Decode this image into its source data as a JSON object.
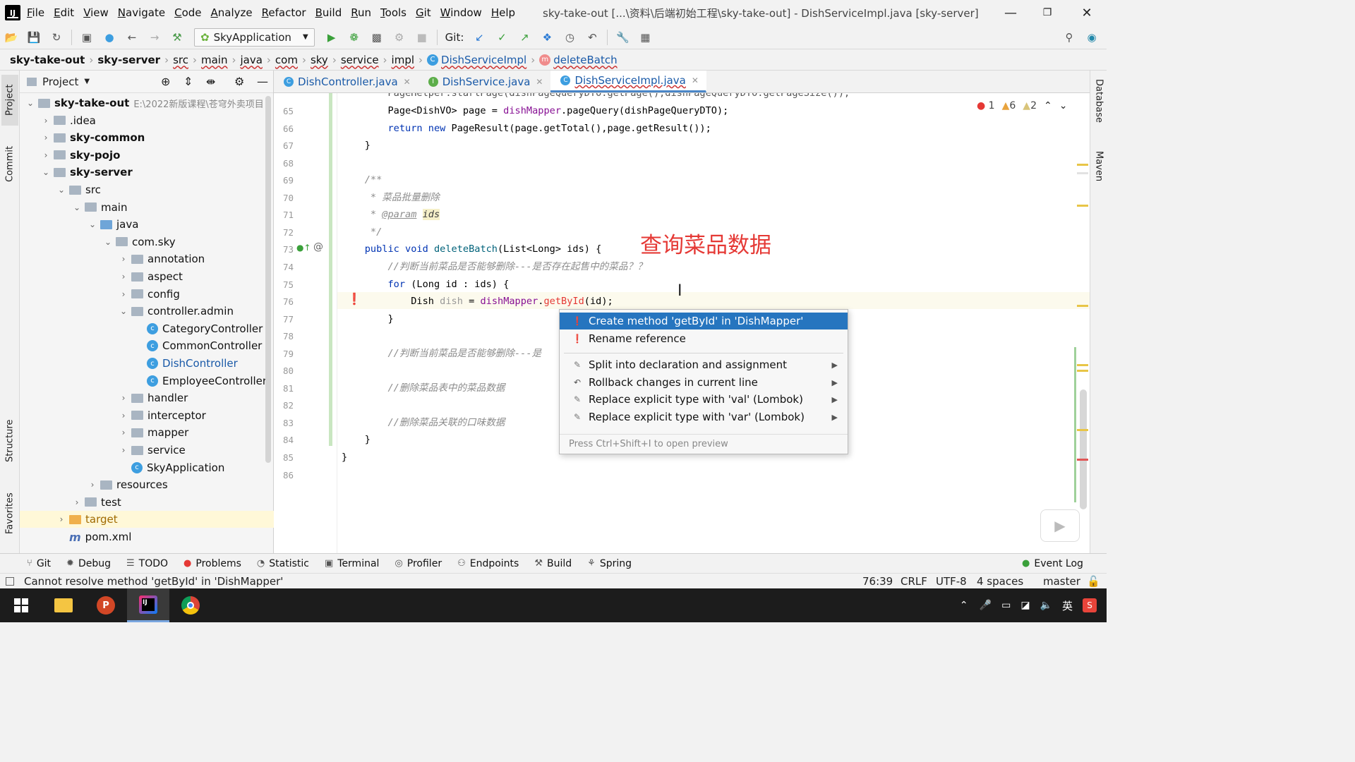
{
  "menu": [
    "File",
    "Edit",
    "View",
    "Navigate",
    "Code",
    "Analyze",
    "Refactor",
    "Build",
    "Run",
    "Tools",
    "Git",
    "Window",
    "Help"
  ],
  "window_title": "sky-take-out [...\\资料\\后端初始工程\\sky-take-out] - DishServiceImpl.java [sky-server]",
  "toolbar": {
    "run_config": "SkyApplication",
    "git_label": "Git:"
  },
  "breadcrumb": [
    "sky-take-out",
    "sky-server",
    "src",
    "main",
    "java",
    "com",
    "sky",
    "service",
    "impl",
    "DishServiceImpl",
    "deleteBatch"
  ],
  "project_panel": {
    "title": "Project",
    "tree": [
      {
        "label": "sky-take-out",
        "path": "E:\\2022新版课程\\苍穹外卖项目",
        "indent": 0,
        "arrow": "v",
        "icon": "module",
        "bold": true
      },
      {
        "label": ".idea",
        "indent": 1,
        "arrow": ">",
        "icon": "folder"
      },
      {
        "label": "sky-common",
        "indent": 1,
        "arrow": ">",
        "icon": "module",
        "bold": true
      },
      {
        "label": "sky-pojo",
        "indent": 1,
        "arrow": ">",
        "icon": "module",
        "bold": true
      },
      {
        "label": "sky-server",
        "indent": 1,
        "arrow": "v",
        "icon": "module",
        "bold": true
      },
      {
        "label": "src",
        "indent": 2,
        "arrow": "v",
        "icon": "folder"
      },
      {
        "label": "main",
        "indent": 3,
        "arrow": "v",
        "icon": "folder"
      },
      {
        "label": "java",
        "indent": 4,
        "arrow": "v",
        "icon": "folder-blue"
      },
      {
        "label": "com.sky",
        "indent": 5,
        "arrow": "v",
        "icon": "folder"
      },
      {
        "label": "annotation",
        "indent": 6,
        "arrow": ">",
        "icon": "folder"
      },
      {
        "label": "aspect",
        "indent": 6,
        "arrow": ">",
        "icon": "folder"
      },
      {
        "label": "config",
        "indent": 6,
        "arrow": ">",
        "icon": "folder"
      },
      {
        "label": "controller.admin",
        "indent": 6,
        "arrow": "v",
        "icon": "folder"
      },
      {
        "label": "CategoryController",
        "indent": 7,
        "arrow": "",
        "icon": "class"
      },
      {
        "label": "CommonController",
        "indent": 7,
        "arrow": "",
        "icon": "class"
      },
      {
        "label": "DishController",
        "indent": 7,
        "arrow": "",
        "icon": "class",
        "blue": true
      },
      {
        "label": "EmployeeController",
        "indent": 7,
        "arrow": "",
        "icon": "class"
      },
      {
        "label": "handler",
        "indent": 6,
        "arrow": ">",
        "icon": "folder"
      },
      {
        "label": "interceptor",
        "indent": 6,
        "arrow": ">",
        "icon": "folder"
      },
      {
        "label": "mapper",
        "indent": 6,
        "arrow": ">",
        "icon": "folder"
      },
      {
        "label": "service",
        "indent": 6,
        "arrow": ">",
        "icon": "folder"
      },
      {
        "label": "SkyApplication",
        "indent": 6,
        "arrow": "",
        "icon": "class"
      },
      {
        "label": "resources",
        "indent": 4,
        "arrow": ">",
        "icon": "folder"
      },
      {
        "label": "test",
        "indent": 3,
        "arrow": ">",
        "icon": "folder"
      },
      {
        "label": "target",
        "indent": 2,
        "arrow": ">",
        "icon": "folder-orange",
        "sel": true
      },
      {
        "label": "pom.xml",
        "indent": 2,
        "arrow": "",
        "icon": "maven"
      }
    ]
  },
  "tabs": [
    {
      "label": "DishController.java",
      "icon": "C"
    },
    {
      "label": "DishService.java",
      "icon": "I"
    },
    {
      "label": "DishServiceImpl.java",
      "icon": "C",
      "active": true
    }
  ],
  "inspections": {
    "errors": "1",
    "warnings": "6",
    "weak": "2"
  },
  "code": [
    {
      "n": "65",
      "html": "        Page&lt;DishVO&gt; page = <span class=\"fld\">dishMapper</span>.pageQuery(dishPageQueryDTO);"
    },
    {
      "n": "66",
      "html": "        <span class=\"kw\">return new</span> PageResult(page.getTotal(),page.getResult());"
    },
    {
      "n": "67",
      "html": "    }"
    },
    {
      "n": "68",
      "html": ""
    },
    {
      "n": "69",
      "html": "    <span class=\"cm\">/**</span>"
    },
    {
      "n": "70",
      "html": "<span class=\"cm\">     * 菜品批量删除</span>"
    },
    {
      "n": "71",
      "html": "<span class=\"cm\">     * <u>@param</u> </span><span style=\"background:#f5efc8;color:#3d3d3d;font-style:italic\">ids</span>"
    },
    {
      "n": "72",
      "html": "<span class=\"cm\">     */</span>"
    },
    {
      "n": "73",
      "html": "    <span class=\"kw\">public void</span> <span class=\"fn\">deleteBatch</span>(List&lt;Long&gt; ids) {"
    },
    {
      "n": "74",
      "html": "        <span class=\"cm\">//判断当前菜品是否能够删除---是否存在起售中的菜品？？</span>"
    },
    {
      "n": "75",
      "html": "        <span class=\"kw\">for</span> (Long id : ids) {"
    },
    {
      "n": "76",
      "html": "            Dish <span style=\"color:#999\">dish</span> = <span class=\"fld\">dishMapper</span>.<span style=\"color:#e53935\">getById</span>(id);"
    },
    {
      "n": "77",
      "html": "        }"
    },
    {
      "n": "78",
      "html": ""
    },
    {
      "n": "79",
      "html": "        <span class=\"cm\">//判断当前菜品是否能够删除---是</span>"
    },
    {
      "n": "80",
      "html": ""
    },
    {
      "n": "81",
      "html": "        <span class=\"cm\">//删除菜品表中的菜品数据</span>"
    },
    {
      "n": "82",
      "html": ""
    },
    {
      "n": "83",
      "html": "        <span class=\"cm\">//删除菜品关联的口味数据</span>"
    },
    {
      "n": "84",
      "html": "    }"
    },
    {
      "n": "85",
      "html": "}"
    },
    {
      "n": "86",
      "html": ""
    }
  ],
  "annotation_text": "查询菜品数据",
  "popup": {
    "items": [
      {
        "label": "Create method 'getById' in 'DishMapper'",
        "icon": "error",
        "sel": true
      },
      {
        "label": "Rename reference",
        "icon": "error"
      },
      {
        "label": "Split into declaration and assignment",
        "icon": "pen",
        "sub": true
      },
      {
        "label": "Rollback changes in current line",
        "icon": "undo",
        "sub": true
      },
      {
        "label": "Replace explicit type with 'val' (Lombok)",
        "icon": "pen",
        "sub": true
      },
      {
        "label": "Replace explicit type with 'var' (Lombok)",
        "icon": "pen",
        "sub": true
      }
    ],
    "footer": "Press Ctrl+Shift+I to open preview"
  },
  "bottom_tools": [
    "Git",
    "Debug",
    "TODO",
    "Problems",
    "Statistic",
    "Terminal",
    "Profiler",
    "Endpoints",
    "Build",
    "Spring"
  ],
  "event_log": "Event Log",
  "status": {
    "message": "Cannot resolve method 'getById' in 'DishMapper'",
    "position": "76:39",
    "line_sep": "CRLF",
    "encoding": "UTF-8",
    "indent": "4 spaces",
    "branch": "master"
  },
  "left_tabs": [
    "Project",
    "Commit",
    "Structure",
    "Favorites"
  ],
  "right_tabs": [
    "Database",
    "Maven"
  ]
}
